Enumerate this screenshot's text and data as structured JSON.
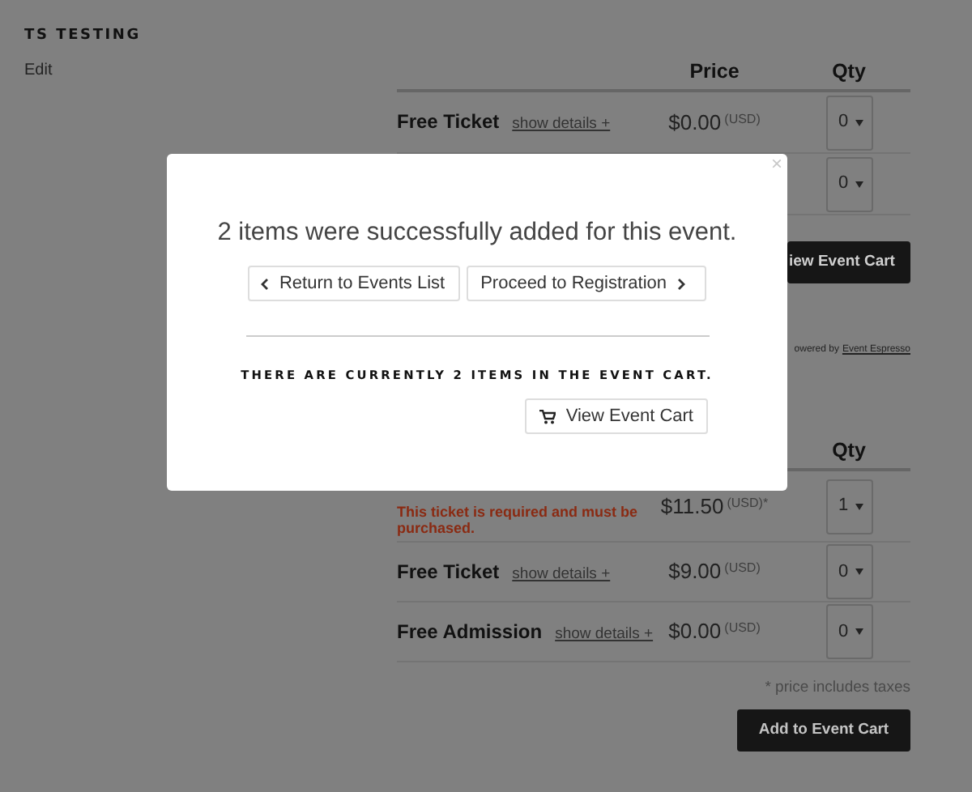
{
  "event": {
    "title": "TS TESTING",
    "edit_link": "Edit"
  },
  "top_table": {
    "columns": [
      "Price",
      "Qty"
    ],
    "rows": [
      {
        "name": "Free Ticket",
        "details_link": "show details +",
        "price": "$0.00",
        "currency": "(USD)",
        "qty": "0"
      },
      {
        "qty": "0"
      }
    ],
    "cart_button": "iew Event Cart"
  },
  "powered_by": {
    "text": "owered by",
    "link": "Event Espresso"
  },
  "bottom_table": {
    "columns": [
      "Qty"
    ],
    "rows": [
      {
        "note": "This ticket is required and must be purchased.",
        "price": "$11.50",
        "currency": "(USD)*",
        "qty": "1"
      },
      {
        "name": "Free Ticket",
        "details_link": "show details +",
        "price": "$9.00",
        "currency": "(USD)",
        "qty": "0"
      },
      {
        "name": "Free Admission",
        "details_link": "show details +",
        "price": "$0.00",
        "currency": "(USD)",
        "qty": "0"
      }
    ],
    "footnote": "* price includes taxes",
    "add_button": "Add to Event Cart"
  },
  "modal": {
    "close": "×",
    "message": "2 items were successfully added for this event.",
    "buttons": [
      {
        "label": "Return to Events List",
        "kind": "back"
      },
      {
        "label": "Proceed to Registration",
        "kind": "forward"
      }
    ],
    "cart_summary": "THERE ARE CURRENTLY 2 ITEMS IN THE EVENT CART.",
    "view_cart_button": "View Event Cart"
  }
}
